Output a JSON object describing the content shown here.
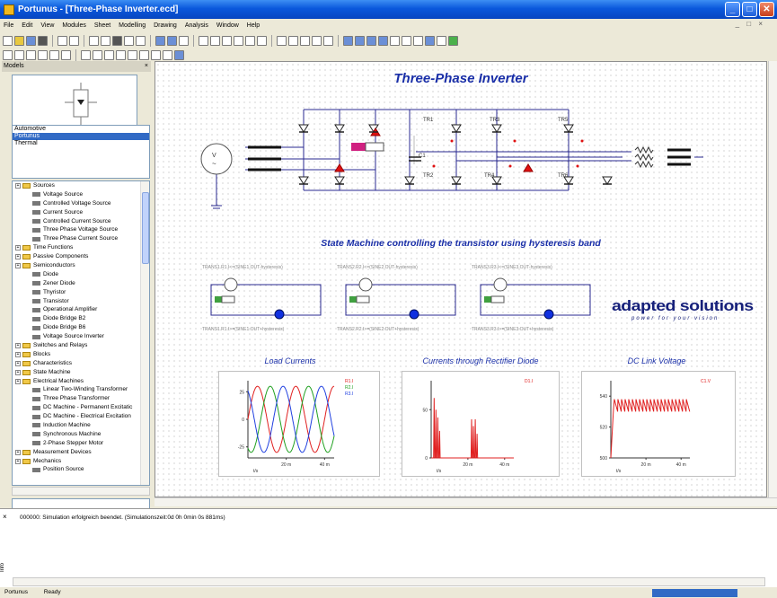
{
  "window": {
    "title": "Portunus - [Three-Phase Inverter.ecd]"
  },
  "menu": [
    "File",
    "Edit",
    "View",
    "Modules",
    "Sheet",
    "Modelling",
    "Drawing",
    "Analysis",
    "Window",
    "Help"
  ],
  "models_pane": {
    "header": "Models",
    "libraries": [
      "Automotive",
      "Portunus",
      "Thermal"
    ],
    "selected_library": "Portunus",
    "tree": [
      {
        "label": "Sources",
        "level": 0,
        "type": "folder"
      },
      {
        "label": "Voltage Source",
        "level": 1,
        "type": "leaf"
      },
      {
        "label": "Controlled Voltage Source",
        "level": 1,
        "type": "leaf"
      },
      {
        "label": "Current Source",
        "level": 1,
        "type": "leaf"
      },
      {
        "label": "Controlled Current Source",
        "level": 1,
        "type": "leaf"
      },
      {
        "label": "Three Phase Voltage Source",
        "level": 1,
        "type": "leaf"
      },
      {
        "label": "Three Phase Current Source",
        "level": 1,
        "type": "leaf"
      },
      {
        "label": "Time Functions",
        "level": 0,
        "type": "folder"
      },
      {
        "label": "Passive Components",
        "level": 0,
        "type": "folder"
      },
      {
        "label": "Semiconductors",
        "level": 0,
        "type": "folder"
      },
      {
        "label": "Diode",
        "level": 1,
        "type": "leaf"
      },
      {
        "label": "Zener Diode",
        "level": 1,
        "type": "leaf"
      },
      {
        "label": "Thyristor",
        "level": 1,
        "type": "leaf"
      },
      {
        "label": "Transistor",
        "level": 1,
        "type": "leaf"
      },
      {
        "label": "Operational Amplifier",
        "level": 1,
        "type": "leaf"
      },
      {
        "label": "Diode Bridge B2",
        "level": 1,
        "type": "leaf"
      },
      {
        "label": "Diode Bridge B6",
        "level": 1,
        "type": "leaf"
      },
      {
        "label": "Voltage Source Inverter",
        "level": 1,
        "type": "leaf"
      },
      {
        "label": "Switches and Relays",
        "level": 0,
        "type": "folder"
      },
      {
        "label": "Blocks",
        "level": 0,
        "type": "folder"
      },
      {
        "label": "Characteristics",
        "level": 0,
        "type": "folder"
      },
      {
        "label": "State Machine",
        "level": 0,
        "type": "folder"
      },
      {
        "label": "Electrical Machines",
        "level": 0,
        "type": "folder"
      },
      {
        "label": "Linear Two-Winding Transformer",
        "level": 1,
        "type": "leaf"
      },
      {
        "label": "Three Phase Transformer",
        "level": 1,
        "type": "leaf"
      },
      {
        "label": "DC Machine - Permanent Excitatic",
        "level": 1,
        "type": "leaf"
      },
      {
        "label": "DC Machine - Electrical Excitation",
        "level": 1,
        "type": "leaf"
      },
      {
        "label": "Induction Machine",
        "level": 1,
        "type": "leaf"
      },
      {
        "label": "Synchronous Machine",
        "level": 1,
        "type": "leaf"
      },
      {
        "label": "2-Phase Stepper Motor",
        "level": 1,
        "type": "leaf"
      },
      {
        "label": "Measurement Devices",
        "level": 0,
        "type": "folder"
      },
      {
        "label": "Mechanics",
        "level": 0,
        "type": "folder"
      },
      {
        "label": "Position Source",
        "level": 1,
        "type": "leaf"
      }
    ]
  },
  "sheet": {
    "title": "Three-Phase Inverter",
    "section2_title": "State Machine controlling the transistor using hysteresis band",
    "logo_main": "adapted solutions",
    "logo_sub": "power for your vision",
    "component_labels": [
      "C1",
      "TR1",
      "TR2",
      "TR3",
      "TR4",
      "TR5",
      "TR6"
    ],
    "sm_labels_top": [
      "TRANS1.R1.I<=(SINE1.OUT-hysteresis)",
      "TRANS2.R2.I<=(SINE2.OUT-hysteresis)",
      "TRANS3.R3.I<=(SINE3.OUT-hysteresis)"
    ],
    "sm_labels_bottom": [
      "TRANS1.R1.I>=(SINE1.OUT+hysteresis)",
      "TRANS2.R2.I>=(SINE2.OUT+hysteresis)",
      "TRANS3.R3.I>=(SINE3.OUT+hysteresis)"
    ],
    "plot_titles": [
      "Load Currents",
      "Currents through Rectifier Diode",
      "DC Link Voltage"
    ]
  },
  "chart_data": [
    {
      "type": "line",
      "title": "Load Currents",
      "xlabel": "t/s",
      "x_ticks": [
        "20 m",
        "40 m"
      ],
      "y_ticks": [
        25,
        0,
        -25
      ],
      "ylim": [
        -35,
        35
      ],
      "xlim": [
        0,
        0.045
      ],
      "series": [
        {
          "name": "R1.I",
          "color": "#e02020"
        },
        {
          "name": "R2.I",
          "color": "#20a020"
        },
        {
          "name": "R3.I",
          "color": "#2040e0"
        }
      ]
    },
    {
      "type": "line",
      "title": "Currents through Rectifier Diode",
      "xlabel": "t/s",
      "x_ticks": [
        "20 m",
        "40 m"
      ],
      "y_ticks": [
        50,
        0
      ],
      "ylim": [
        0,
        80
      ],
      "xlim": [
        0,
        0.045
      ],
      "series": [
        {
          "name": "D1.I",
          "color": "#e02020"
        }
      ]
    },
    {
      "type": "line",
      "title": "DC Link Voltage",
      "xlabel": "t/s",
      "x_ticks": [
        "20 m",
        "40 m"
      ],
      "y_ticks": [
        540,
        520,
        500
      ],
      "ylim": [
        500,
        550
      ],
      "xlim": [
        0,
        0.045
      ],
      "series": [
        {
          "name": "C1.V",
          "color": "#e02020"
        }
      ]
    }
  ],
  "output": {
    "message": "000000: Simulation erfolgreich beendet. (Simulationszeit:0d 0h 0min 0s 881ms)",
    "side_label": "Info"
  },
  "status": {
    "app": "Portunus",
    "state": "Ready"
  },
  "colors": {
    "titlebar": "#0a58dc",
    "accent": "#1a2fa8",
    "selection": "#316ac5"
  }
}
